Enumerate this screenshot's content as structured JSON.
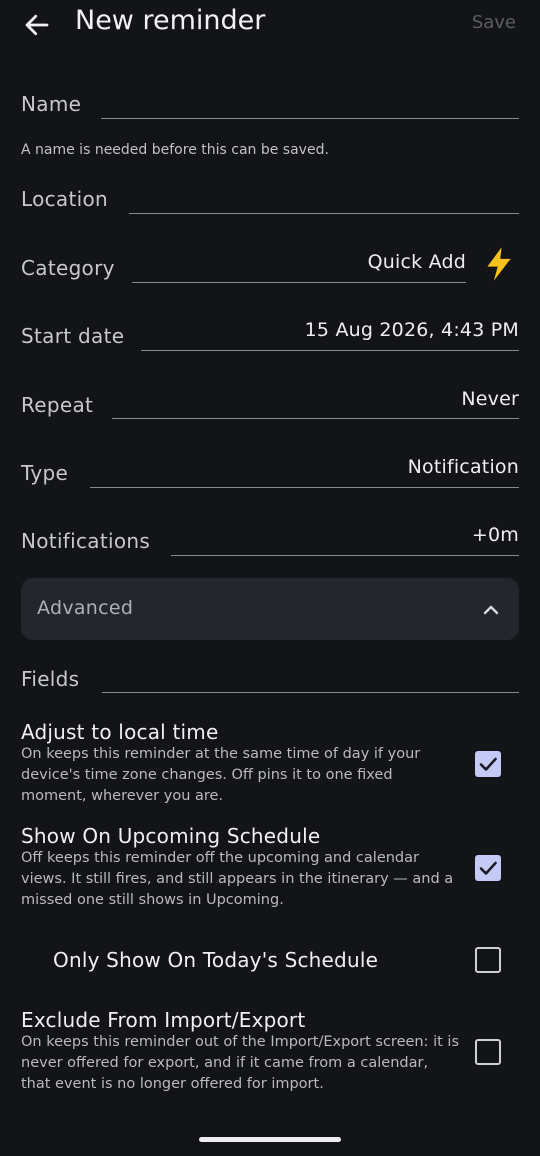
{
  "header": {
    "title": "New reminder",
    "save_label": "Save"
  },
  "form": {
    "name_label": "Name",
    "name_value": "",
    "name_helper": "A name is needed before this can be saved.",
    "location_label": "Location",
    "location_value": "",
    "category_label": "Category",
    "category_value": "Quick Add",
    "start_label": "Start date",
    "start_value": "15 Aug 2026, 4:43 PM",
    "repeat_label": "Repeat",
    "repeat_value": "Never",
    "type_label": "Type",
    "type_value": "Notification",
    "notifications_label": "Notifications",
    "notifications_value": "+0m"
  },
  "advanced": {
    "label": "Advanced",
    "fields_label": "Fields",
    "fields_value": "",
    "options": [
      {
        "title": "Adjust to local time",
        "desc": "On keeps this reminder at the same time of day if your device's time zone changes. Off pins it to one fixed moment, wherever you are.",
        "checked": true
      },
      {
        "title": "Show On Upcoming Schedule",
        "desc": "Off keeps this reminder off the upcoming and calendar views. It still fires, and still appears in the itinerary — and a missed one still shows in Upcoming.",
        "checked": true
      },
      {
        "title": "Only Show On Today's Schedule",
        "desc": "",
        "checked": false
      },
      {
        "title": "Exclude From Import/Export",
        "desc": "On keeps this reminder out of the Import/Export screen: it is never offered for export, and if it came from a calendar, that event is no longer offered for import.",
        "checked": false
      }
    ]
  },
  "colors": {
    "background": "#131418",
    "accent_check": "#c4c9f5",
    "bolt": "#f7c21b"
  },
  "icons": {
    "back": "arrow-left-icon",
    "category": "lightning-bolt-icon",
    "advanced": "chevron-up-icon",
    "checked": "checkbox-checked-icon",
    "unchecked": "checkbox-empty-icon"
  }
}
